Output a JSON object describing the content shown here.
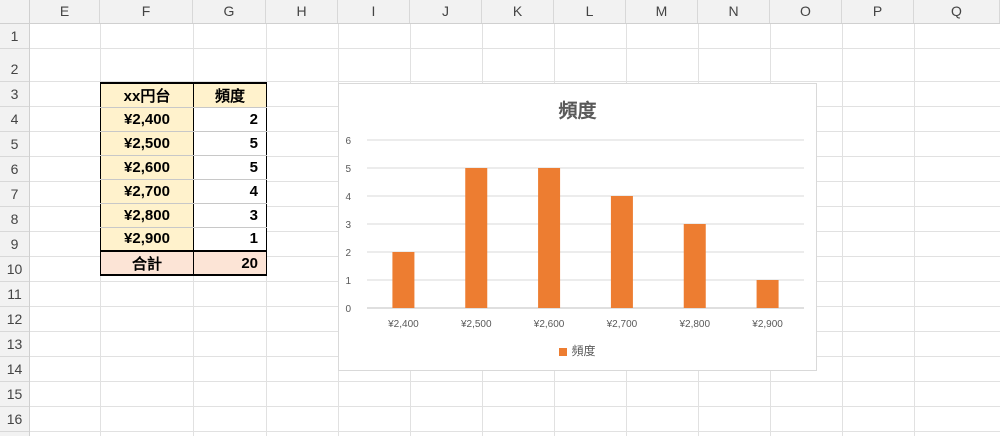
{
  "columns": [
    "E",
    "F",
    "G",
    "H",
    "I",
    "J",
    "K",
    "L",
    "M",
    "N",
    "O",
    "P",
    "Q"
  ],
  "rows": [
    "1",
    "2",
    "3",
    "4",
    "5",
    "6",
    "7",
    "8",
    "9",
    "10",
    "11",
    "12",
    "13",
    "14",
    "15",
    "16"
  ],
  "table": {
    "header": {
      "range": "xx円台",
      "freq": "頻度"
    },
    "rows": [
      {
        "range": "¥2,400",
        "freq": "2"
      },
      {
        "range": "¥2,500",
        "freq": "5"
      },
      {
        "range": "¥2,600",
        "freq": "5"
      },
      {
        "range": "¥2,700",
        "freq": "4"
      },
      {
        "range": "¥2,800",
        "freq": "3"
      },
      {
        "range": "¥2,900",
        "freq": "1"
      }
    ],
    "total": {
      "label": "合計",
      "value": "20"
    }
  },
  "chart_data": {
    "type": "bar",
    "title": "頻度",
    "categories": [
      "¥2,400",
      "¥2,500",
      "¥2,600",
      "¥2,700",
      "¥2,800",
      "¥2,900"
    ],
    "series": [
      {
        "name": "頻度",
        "values": [
          2,
          5,
          5,
          4,
          3,
          1
        ],
        "color": "#ed7d31"
      }
    ],
    "ylim": [
      0,
      6
    ],
    "yticks": [
      "0",
      "1",
      "2",
      "3",
      "4",
      "5",
      "6"
    ],
    "grid": true,
    "legend": "bottom"
  }
}
